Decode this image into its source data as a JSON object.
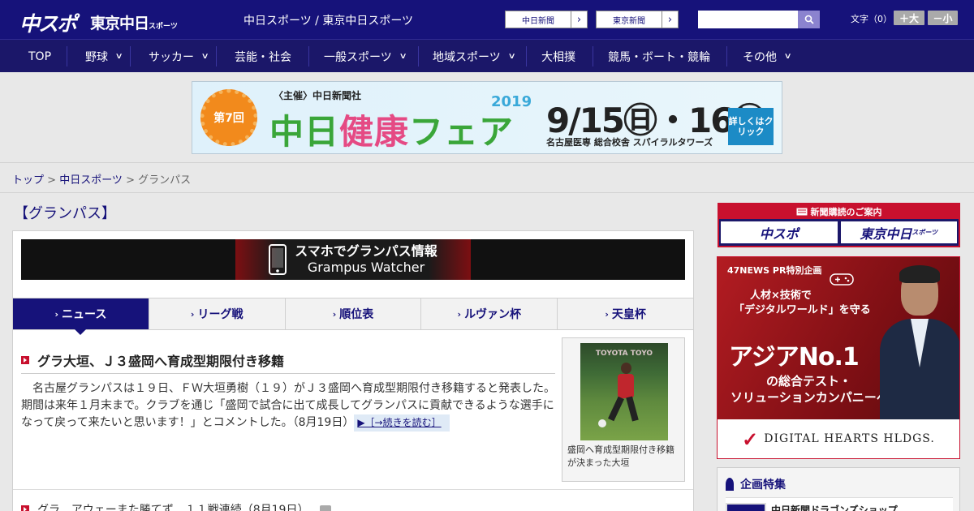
{
  "header": {
    "logo_chuspo": "中スポ",
    "logo_tokyo": "東京中日",
    "logo_tokyo_small": "スポーツ",
    "site_title": "中日スポーツ / 東京中日スポーツ",
    "links": [
      {
        "label": "中日新聞",
        "arrow": "›"
      },
      {
        "label": "東京新聞",
        "arrow": "›"
      }
    ],
    "search": {
      "placeholder": "",
      "value": ""
    },
    "font_size": {
      "label": "文字（0）",
      "larger": "＋大",
      "smaller": "－小"
    }
  },
  "nav": {
    "items": [
      {
        "label": "TOP",
        "dropdown": false
      },
      {
        "label": "野球",
        "dropdown": true
      },
      {
        "label": "サッカー",
        "dropdown": true
      },
      {
        "label": "芸能・社会",
        "dropdown": false
      },
      {
        "label": "一般スポーツ",
        "dropdown": true
      },
      {
        "label": "地域スポーツ",
        "dropdown": true
      },
      {
        "label": "大相撲",
        "dropdown": false
      },
      {
        "label": "競馬・ボート・競輪",
        "dropdown": false
      },
      {
        "label": "その他",
        "dropdown": true
      }
    ],
    "chevron": "∨"
  },
  "ad_banner": {
    "badge": "第7回",
    "host": "〈主催〉中日新聞社",
    "title_green": "中日",
    "title_pink": "健康",
    "title_rest": "フェア",
    "year": "2019",
    "dates": "9/15㊐・16㊗",
    "venue": "名古屋医専 総合校舎 スパイラルタワーズ",
    "detail_button": "詳しくはクリック"
  },
  "breadcrumb": {
    "items": [
      "トップ",
      "中日スポーツ"
    ],
    "sep": " > ",
    "current": "グランパス"
  },
  "page": {
    "heading": "【グランパス】"
  },
  "grampus_banner": {
    "line1": "スマホでグランパス情報",
    "line2": "Grampus Watcher"
  },
  "tabs": [
    {
      "label": "ニュース",
      "active": true
    },
    {
      "label": "リーグ戦",
      "active": false
    },
    {
      "label": "順位表",
      "active": false
    },
    {
      "label": "ルヴァン杯",
      "active": false
    },
    {
      "label": "天皇杯",
      "active": false
    }
  ],
  "tab_caret": "›",
  "article": {
    "title": "グラ大垣、Ｊ３盛岡へ育成型期限付き移籍",
    "body": "名古屋グランパスは１９日、ＦＷ大垣勇樹（１９）がＪ３盛岡へ育成型期限付き移籍すると発表した。期間は来年１月末まで。クラブを通じ「盛岡で試合に出て成長してグランパスに貢献できるような選手になって戻って来たいと思います！」とコメントした。（8月19日）",
    "readmore": "▶［→続きを読む］",
    "photo_sign": "TOYOTA TOYO",
    "photo_caption": "盛岡へ育成型期限付き移籍が決まった大垣"
  },
  "news_list": [
    {
      "title": "グラ、アウェーまた勝てず…１１戦連続（8月19日）"
    }
  ],
  "sidebar": {
    "subscription": {
      "head": "新聞購読のご案内",
      "logo1": "中スポ",
      "logo2": "東京中日",
      "logo2_small": "スポーツ"
    },
    "ad": {
      "tag": "47NEWS PR特別企画",
      "line1": "人材×技術で",
      "line2": "「デジタルワールド」を守る",
      "asia": "アジアNo.1",
      "line3": "の総合テスト・",
      "line4": "ソリューションカンパニーへ",
      "company": "DIGITAL HEARTS HLDGS."
    },
    "feature": {
      "head": "企画特集",
      "item": "中日新聞ドラゴンズショップ"
    }
  },
  "colors": {
    "brand_navy": "#16127a",
    "accent_red": "#c8102e"
  }
}
